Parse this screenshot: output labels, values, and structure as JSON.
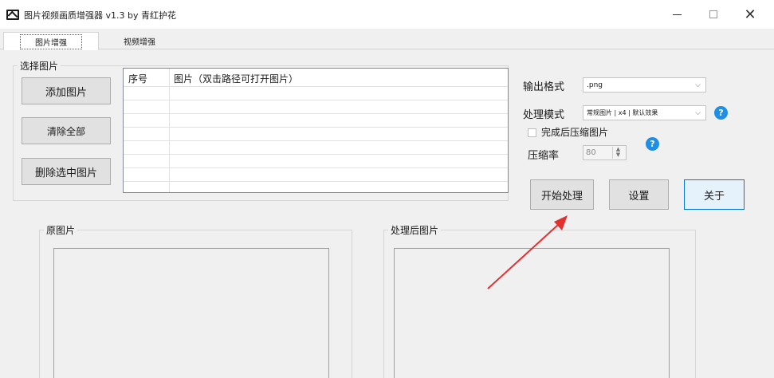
{
  "window": {
    "title": "图片视频画质增强器 v1.3    by 青红护花",
    "controls": {
      "minimize": "–",
      "close": "✕"
    }
  },
  "tabs": [
    {
      "label": "图片增强"
    },
    {
      "label": "视频增强"
    }
  ],
  "select_group": {
    "label": "选择图片",
    "add_button": "添加图片",
    "clear_button": "清除全部",
    "delete_button": "删除选中图片"
  },
  "table": {
    "columns": [
      "序号",
      "图片（双击路径可打开图片）"
    ],
    "rows": []
  },
  "options": {
    "format_label": "输出格式",
    "format_value": ".png",
    "mode_label": "处理模式",
    "mode_value": "常规图片 | x4 | 默认效果",
    "compress_checkbox_label": "完成后压缩图片",
    "compress_checked": false,
    "rate_label": "压缩率",
    "rate_value": "80"
  },
  "actions": {
    "start_button": "开始处理",
    "settings_button": "设置",
    "about_button": "关于"
  },
  "panels": {
    "original_label": "原图片",
    "processed_label": "处理后图片"
  },
  "colors": {
    "accent": "#0078d7",
    "help_icon": "#1f8fe6",
    "annotation_arrow": "#e53030"
  }
}
